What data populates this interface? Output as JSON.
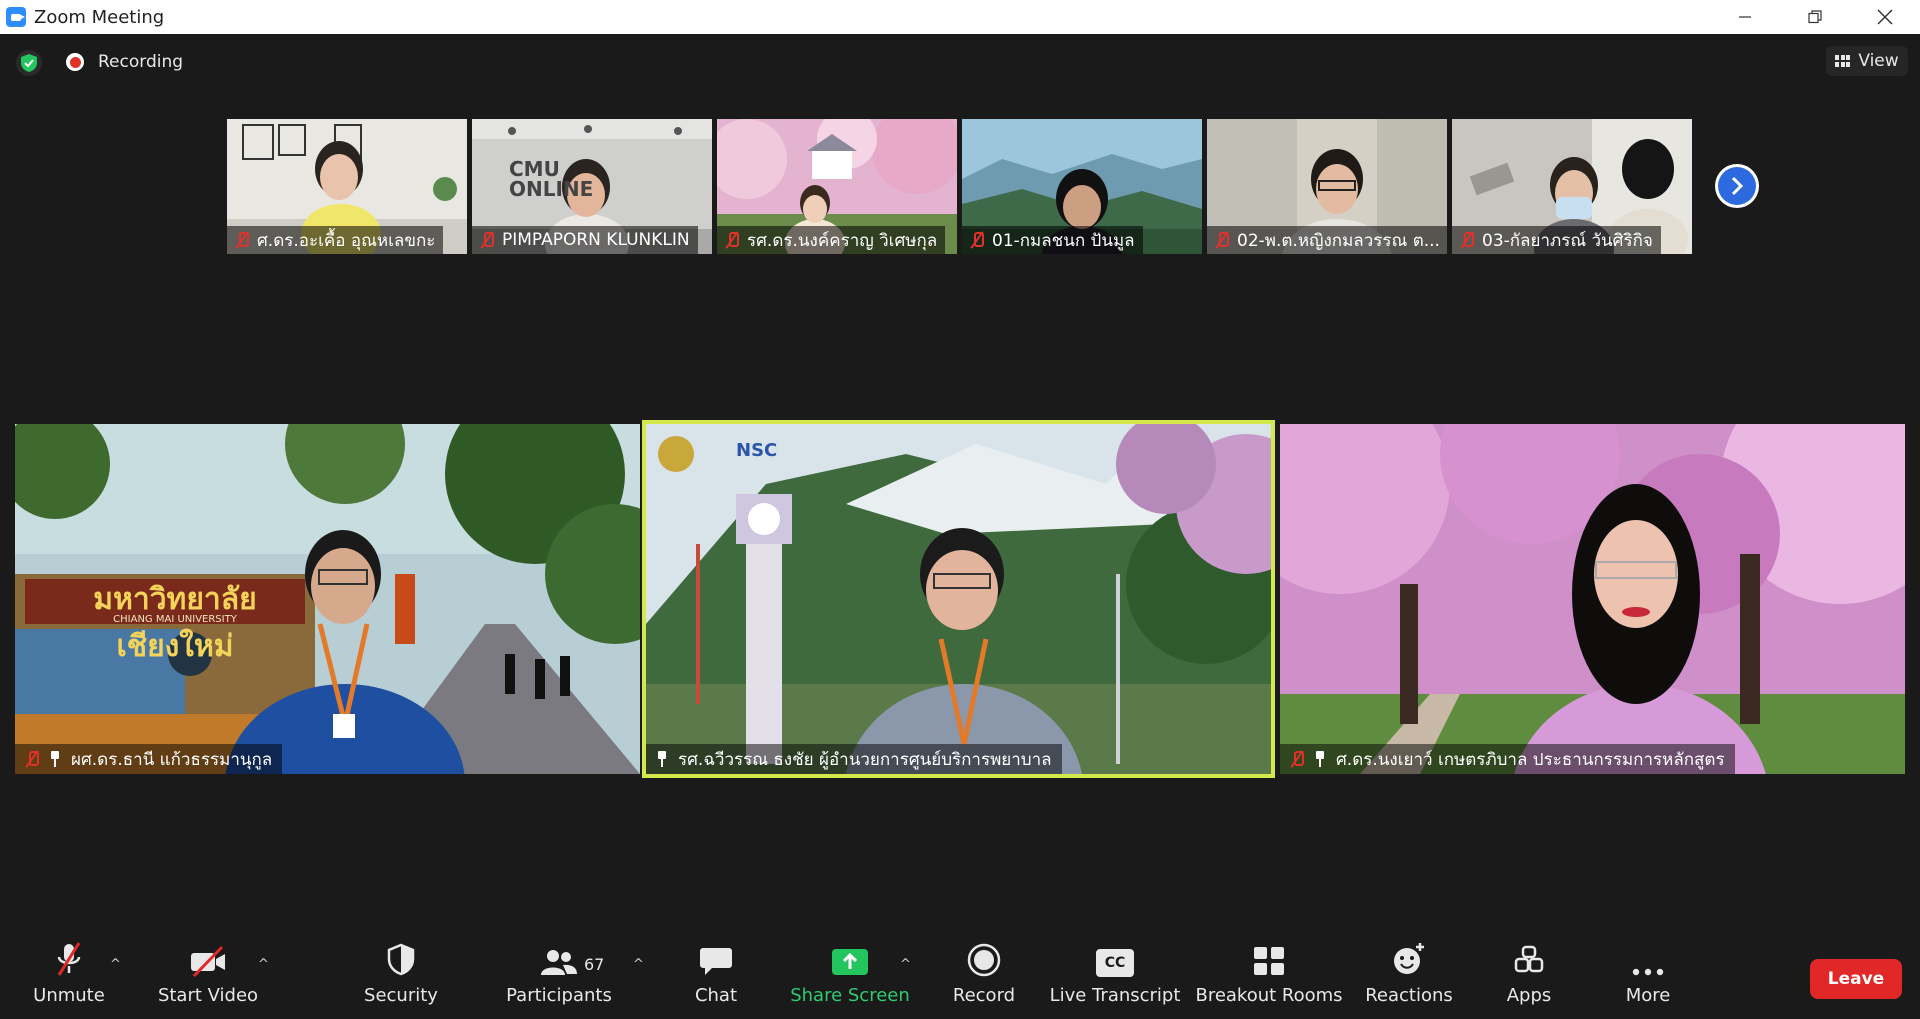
{
  "window": {
    "title": "Zoom Meeting"
  },
  "top": {
    "recording_label": "Recording",
    "view_label": "View"
  },
  "thumbnails": [
    {
      "name": "ศ.ดร.อะเคื้อ อุณหเลขกะ",
      "muted": true
    },
    {
      "name": "PIMPAPORN KLUNKLIN",
      "muted": true,
      "bg_text": "CMU ONLINE"
    },
    {
      "name": "รศ.ดร.นงค์คราญ วิเศษกุล",
      "muted": true
    },
    {
      "name": "01-กมลชนก ปันมูล",
      "muted": true
    },
    {
      "name": "02-พ.ต.หญิงกมลวรรณ ต...",
      "muted": true
    },
    {
      "name": "03-กัลยาภรณ์ วันศิริกิจ",
      "muted": true
    }
  ],
  "tiles": [
    {
      "name": "ผศ.ดร.ธานี  แก้วธรรมานุกูล",
      "muted": true,
      "pinned": true,
      "bg_sign": "มหาวิทยาลัยเชียงใหม่",
      "bg_sign_sub": "CHIANG MAI UNIVERSITY"
    },
    {
      "name": "รศ.ฉวีวรรณ ธงชัย ผู้อำนวยการศูนย์บริการพยาบาล",
      "muted": false,
      "pinned": true,
      "active": true,
      "logo_text": "NSC"
    },
    {
      "name": "ศ.ดร.นงเยาว์  เกษตรภิบาล ประธานกรรมการหลักสูตร",
      "muted": true,
      "pinned": true
    }
  ],
  "toolbar": {
    "unmute": "Unmute",
    "start_video": "Start Video",
    "security": "Security",
    "participants": "Participants",
    "participants_count": "67",
    "chat": "Chat",
    "share_screen": "Share Screen",
    "record": "Record",
    "live_transcript": "Live Transcript",
    "cc_text": "CC",
    "breakout_rooms": "Breakout Rooms",
    "reactions": "Reactions",
    "apps": "Apps",
    "more": "More",
    "leave": "Leave"
  },
  "colors": {
    "active_speaker": "#d3e84a",
    "share_green": "#22c55e",
    "leave_red": "#e02828",
    "accent_blue": "#2d6ae0"
  }
}
